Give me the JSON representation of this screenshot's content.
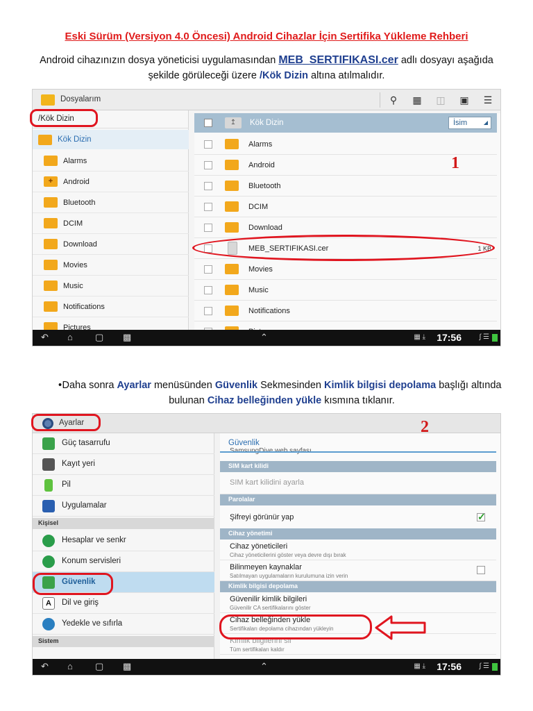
{
  "document": {
    "title": "Eski Sürüm (Versiyon 4.0 Öncesi) Android Cihazlar İçin Sertifika Yükleme Rehberi",
    "intro": {
      "part1": "Android cihazınızın dosya yöneticisi uygulamasından ",
      "file": "MEB_SERTIFIKASI.cer",
      "part2": " adlı dosyayı aşağıda şekilde görüleceği üzere ",
      "dir": "/Kök Dizin",
      "part3": " altına atılmalıdır."
    },
    "step2": {
      "bullet": "•",
      "part1": "Daha sonra ",
      "menu": "Ayarlar",
      "part2": " menüsünden ",
      "tab": "Güvenlik",
      "part3": " Sekmesinden ",
      "heading": "Kimlik bilgisi depolama",
      "part4": " başlığı altında bulunan ",
      "option": "Cihaz belleğinden yükle",
      "part5": " kısmına tıklanır."
    }
  },
  "screenshot1": {
    "marker": "1",
    "app_title": "Dosyalarım",
    "path": "/Kök Dizin",
    "root_label": "Kök Dizin",
    "left_items": [
      "Alarms",
      "Android",
      "Bluetooth",
      "DCIM",
      "Download",
      "Movies",
      "Music",
      "Notifications",
      "Pictures"
    ],
    "list_header": "Kök Dizin",
    "sort_label": "İsim",
    "files": [
      {
        "name": "Alarms",
        "type": "folder",
        "size": ""
      },
      {
        "name": "Android",
        "type": "folder",
        "size": ""
      },
      {
        "name": "Bluetooth",
        "type": "folder",
        "size": ""
      },
      {
        "name": "DCIM",
        "type": "folder",
        "size": ""
      },
      {
        "name": "Download",
        "type": "folder",
        "size": ""
      },
      {
        "name": "MEB_SERTIFIKASI.cer",
        "type": "file",
        "size": "1 KB"
      },
      {
        "name": "Movies",
        "type": "folder",
        "size": ""
      },
      {
        "name": "Music",
        "type": "folder",
        "size": ""
      },
      {
        "name": "Notifications",
        "type": "folder",
        "size": ""
      },
      {
        "name": "Pictures",
        "type": "folder",
        "size": ""
      }
    ],
    "clock": "17:56"
  },
  "screenshot2": {
    "marker": "2",
    "app_title": "Ayarlar",
    "left_items_top": [
      "Güç tasarrufu",
      "Kayıt yeri",
      "Pil",
      "Uygulamalar"
    ],
    "section_personal": "Kişisel",
    "left_items_personal": [
      "Hesaplar ve senkr",
      "Konum servisleri",
      "Güvenlik",
      "Dil ve giriş",
      "Yedekle ve sıfırla"
    ],
    "section_system": "Sistem",
    "right_title": "Güvenlik",
    "right_cut_text": "SamsungDive web sayfası",
    "sections": {
      "sim": "SIM kart kilidi",
      "passwords": "Parolalar",
      "device_admin": "Cihaz yönetimi",
      "credentials": "Kimlik bilgisi depolama"
    },
    "items": {
      "sim_lock": {
        "title": "SIM kart kilidini ayarla"
      },
      "show_password": {
        "title": "Şifreyi görünür yap"
      },
      "device_admins": {
        "title": "Cihaz yöneticileri",
        "sub": "Cihaz yöneticilerini göster veya devre dışı bırak"
      },
      "unknown_sources": {
        "title": "Bilinmeyen kaynaklar",
        "sub": "Satılmayan uygulamaların kurulumuna izin verin"
      },
      "trusted_creds": {
        "title": "Güvenilir kimlik bilgileri",
        "sub": "Güvenilir CA sertifikalarını göster"
      },
      "install_storage": {
        "title": "Cihaz belleğinden yükle",
        "sub": "Sertifikaları depolama cihazından yükleyin"
      },
      "clear_creds": {
        "title": "Kimlik bilgilerini sil",
        "sub": "Tüm sertifikaları kaldır"
      }
    },
    "clock": "17:56"
  },
  "colors": {
    "title_red": "#e01b1b",
    "highlight_blue": "#1f3f8f",
    "annotation_red": "#e0151f",
    "folder": "#f2a81c"
  }
}
